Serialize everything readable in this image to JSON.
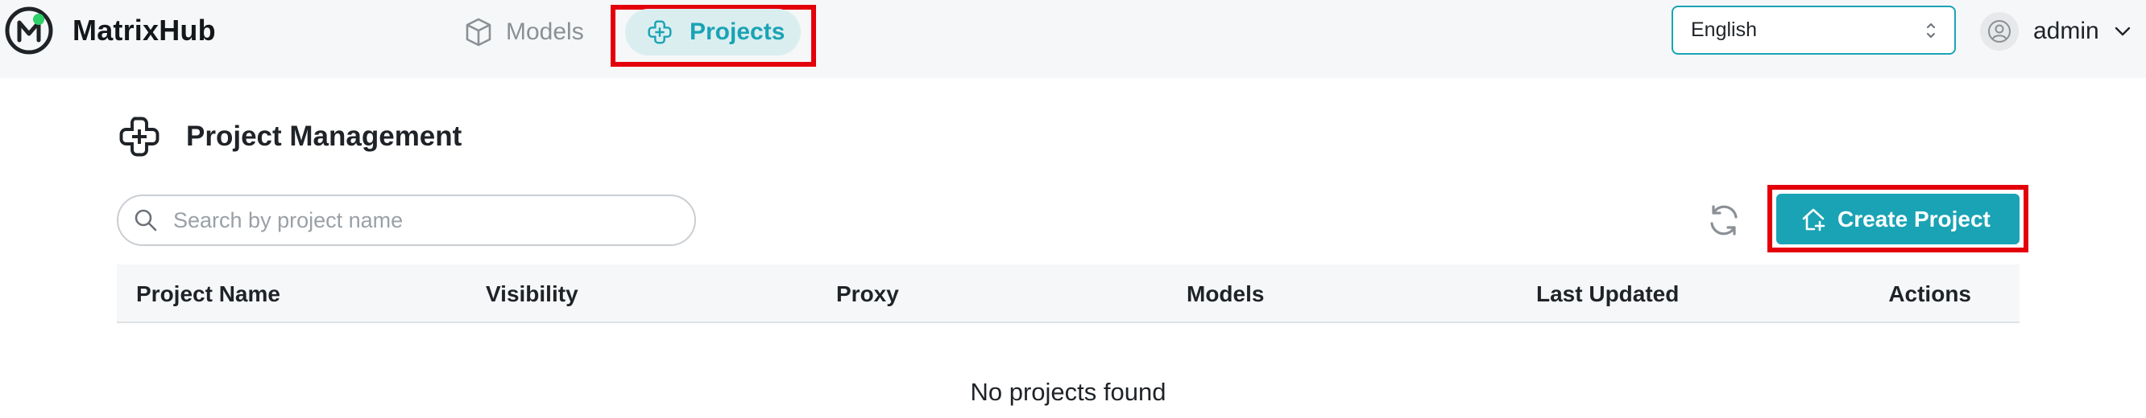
{
  "app": {
    "name": "MatrixHub"
  },
  "nav": {
    "models_label": "Models",
    "projects_label": "Projects"
  },
  "language": {
    "selected": "English"
  },
  "user": {
    "name": "admin"
  },
  "page": {
    "title": "Project Management"
  },
  "search": {
    "placeholder": "Search by project name",
    "value": ""
  },
  "toolbar": {
    "create_label": "Create Project"
  },
  "table": {
    "columns": [
      "Project Name",
      "Visibility",
      "Proxy",
      "Models",
      "Last Updated",
      "Actions"
    ],
    "rows": [],
    "empty_text": "No projects found"
  },
  "colors": {
    "accent": "#1aa3b5",
    "accent_soft": "#daeef0",
    "highlight_box": "#e3000b",
    "logo_green": "#2fd16a"
  },
  "icons": {
    "logo": "matrixhub-logo",
    "models": "cube-icon",
    "projects": "projects-icon",
    "search": "search-icon",
    "refresh": "refresh-icon",
    "create": "house-plus-icon",
    "avatar": "user-circle-icon"
  }
}
